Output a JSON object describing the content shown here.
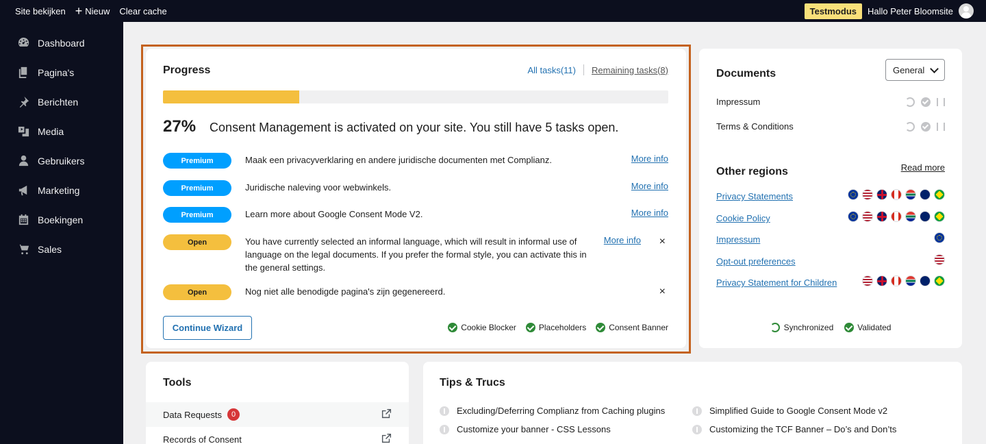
{
  "topbar": {
    "site_link": "Site bekijken",
    "new_label": "Nieuw",
    "clear_cache": "Clear cache",
    "testmodus": "Testmodus",
    "greeting": "Hallo Peter Bloomsite"
  },
  "sidebar": {
    "items": [
      {
        "label": "Dashboard",
        "icon": "dashboard-icon"
      },
      {
        "label": "Pagina's",
        "icon": "pages-icon"
      },
      {
        "label": "Berichten",
        "icon": "pin-icon"
      },
      {
        "label": "Media",
        "icon": "media-icon"
      },
      {
        "label": "Gebruikers",
        "icon": "user-icon"
      },
      {
        "label": "Marketing",
        "icon": "megaphone-icon"
      },
      {
        "label": "Boekingen",
        "icon": "calendar-icon"
      },
      {
        "label": "Sales",
        "icon": "cart-icon"
      }
    ]
  },
  "progress": {
    "title": "Progress",
    "tab_all": "All tasks(11)",
    "tab_remaining": "Remaining tasks(8)",
    "percent_value": 27,
    "percent_text": "27%",
    "message": "Consent Management is activated on your site. You still have 5 tasks open.",
    "tasks": [
      {
        "status": "Premium",
        "text": "Maak een privacyverklaring en andere juridische documenten met Complianz.",
        "link": "More info",
        "dismiss": ""
      },
      {
        "status": "Premium",
        "text": "Juridische naleving voor webwinkels.",
        "link": "More info",
        "dismiss": ""
      },
      {
        "status": "Premium",
        "text": "Learn more about Google Consent Mode V2.",
        "link": "More info",
        "dismiss": ""
      },
      {
        "status": "Open",
        "text": "You have currently selected an informal language, which will result in informal use of language on the legal documents. If you prefer the formal style, you can activate this in the general settings.",
        "link": "More info",
        "dismiss": "×"
      },
      {
        "status": "Open",
        "text": "Nog niet alle benodigde pagina's zijn gegenereerd.",
        "link": "",
        "dismiss": "×"
      }
    ],
    "wizard_button": "Continue Wizard",
    "statuses": [
      "Cookie Blocker",
      "Placeholders",
      "Consent Banner"
    ]
  },
  "documents": {
    "title": "Documents",
    "select_value": "General",
    "docs": [
      "Impressum",
      "Terms & Conditions"
    ],
    "other_regions_title": "Other regions",
    "read_more": "Read more",
    "regions": [
      {
        "label": "Privacy Statements",
        "flags": [
          "eu",
          "us",
          "uk",
          "ca",
          "za",
          "au",
          "br"
        ]
      },
      {
        "label": "Cookie Policy",
        "flags": [
          "eu",
          "us",
          "uk",
          "ca",
          "za",
          "au",
          "br"
        ]
      },
      {
        "label": "Impressum",
        "flags": [
          "eu"
        ]
      },
      {
        "label": "Opt-out preferences",
        "flags": [
          "us"
        ]
      },
      {
        "label": "Privacy Statement for Children",
        "flags": [
          "us",
          "uk",
          "ca",
          "za",
          "au",
          "br"
        ]
      }
    ],
    "status_synced": "Synchronized",
    "status_validated": "Validated"
  },
  "tools": {
    "title": "Tools",
    "rows": [
      {
        "label": "Data Requests",
        "count": "0"
      },
      {
        "label": "Records of Consent",
        "count": ""
      }
    ]
  },
  "tips": {
    "title": "Tips & Trucs",
    "items": [
      "Excluding/Deferring Complianz from Caching plugins",
      "Simplified Guide to Google Consent Mode v2",
      "Customize your banner - CSS Lessons",
      "Customizing the TCF Banner – Do’s and Don’ts"
    ]
  },
  "colors": {
    "accent": "#2271b1",
    "premium": "#009fff",
    "open": "#f4bf3e",
    "success": "#2e8a37",
    "highlight_border": "#c4621e",
    "admin_bar": "#0c0f1e"
  }
}
